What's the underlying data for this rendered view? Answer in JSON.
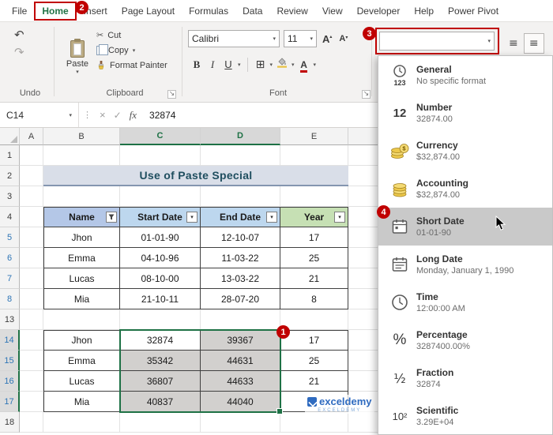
{
  "menubar": {
    "tabs": [
      "File",
      "Home",
      "Insert",
      "Page Layout",
      "Formulas",
      "Data",
      "Review",
      "View",
      "Developer",
      "Help",
      "Power Pivot"
    ],
    "active_tab": "Home"
  },
  "annotations": [
    "1",
    "2",
    "3",
    "4"
  ],
  "icons": {
    "dropdown": "▾",
    "caret_up": "▴",
    "undo": "↶",
    "redo": "↷",
    "cut": "✂",
    "borders": "⊞",
    "menu": "≡",
    "dots": "⋮",
    "cancel": "×",
    "check": "✓",
    "launcher": "↘",
    "grow_letter": "A",
    "shrink_letter": "A",
    "font_color_letter": "A",
    "bold": "B",
    "italic": "I",
    "underline": "U"
  },
  "ribbon": {
    "undo": {
      "group_label": "Undo"
    },
    "clipboard": {
      "paste_label": "Paste",
      "cut_label": "Cut",
      "copy_label": "Copy",
      "format_painter_label": "Format Painter",
      "group_label": "Clipboard"
    },
    "font": {
      "font_name": "Calibri",
      "font_size": "11",
      "group_label": "Font"
    },
    "number_format": {
      "value": ""
    }
  },
  "formula_bar": {
    "name_box": "C14",
    "fx_label": "fx",
    "value": "32874"
  },
  "grid": {
    "col_headers": [
      "A",
      "B",
      "C",
      "D",
      "E"
    ],
    "row_numbers": [
      "1",
      "2",
      "3",
      "4",
      "5",
      "6",
      "7",
      "8",
      "13",
      "14",
      "15",
      "16",
      "17",
      "18"
    ],
    "title": "Use of Paste Special",
    "table1": {
      "headers": [
        "Name",
        "Start Date",
        "End Date",
        "Year"
      ],
      "rows": [
        [
          "Jhon",
          "01-01-90",
          "12-10-07",
          "17"
        ],
        [
          "Emma",
          "04-10-96",
          "11-03-22",
          "25"
        ],
        [
          "Lucas",
          "08-10-00",
          "13-03-22",
          "21"
        ],
        [
          "Mia",
          "21-10-11",
          "28-07-20",
          "8"
        ]
      ]
    },
    "table2": {
      "rows": [
        [
          "Jhon",
          "32874",
          "39367",
          "17"
        ],
        [
          "Emma",
          "35342",
          "44631",
          "25"
        ],
        [
          "Lucas",
          "36807",
          "44633",
          "21"
        ],
        [
          "Mia",
          "40837",
          "44040",
          "8"
        ]
      ]
    },
    "selection": {
      "range": "C14:D17",
      "active_cell": "C14"
    }
  },
  "format_dropdown": {
    "items": [
      {
        "icon": "general-clock-icon",
        "glyph": "123",
        "title": "General",
        "subtitle": "No specific format"
      },
      {
        "icon": "number-icon",
        "glyph": "12",
        "title": "Number",
        "subtitle": "32874.00"
      },
      {
        "icon": "currency-coins-icon",
        "glyph": "",
        "title": "Currency",
        "subtitle": "$32,874.00"
      },
      {
        "icon": "accounting-coins-icon",
        "glyph": "",
        "title": "Accounting",
        "subtitle": "$32,874.00"
      },
      {
        "icon": "short-date-calendar-icon",
        "glyph": "",
        "title": "Short Date",
        "subtitle": "01-01-90"
      },
      {
        "icon": "long-date-calendar-icon",
        "glyph": "",
        "title": "Long Date",
        "subtitle": "Monday, January 1, 1990"
      },
      {
        "icon": "time-clock-icon",
        "glyph": "",
        "title": "Time",
        "subtitle": "12:00:00 AM"
      },
      {
        "icon": "percentage-icon",
        "glyph": "%",
        "title": "Percentage",
        "subtitle": "3287400.00%"
      },
      {
        "icon": "fraction-icon",
        "glyph": "½",
        "title": "Fraction",
        "subtitle": "32874"
      },
      {
        "icon": "scientific-icon",
        "glyph": "10²",
        "title": "Scientific",
        "subtitle": "3.29E+04"
      }
    ],
    "highlighted_item": "Short Date"
  },
  "watermark": {
    "text": "exceldemy",
    "subtext": "EXCELDEMY"
  },
  "colors": {
    "accent_green": "#1E7145",
    "annotation_red": "#C00000",
    "selection_gray": "#D2D0CE",
    "title_text": "#1F4E5F"
  }
}
